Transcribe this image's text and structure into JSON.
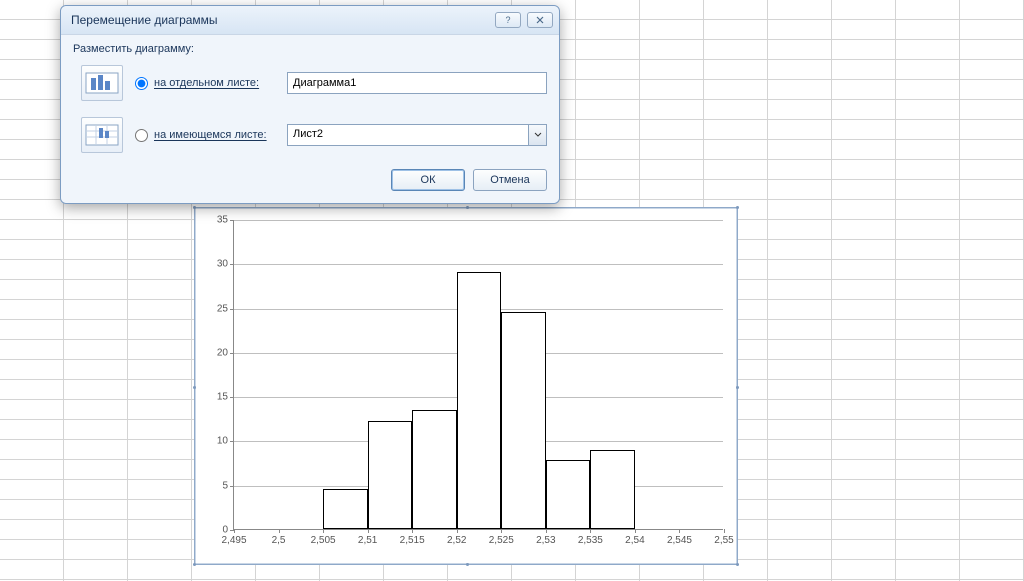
{
  "dialog": {
    "title": "Перемещение диаграммы",
    "group_label": "Разместить диаграмму:",
    "option_new_sheet": {
      "label": "на отдельном листе:",
      "value": "Диаграмма1",
      "selected": true
    },
    "option_existing_sheet": {
      "label": "на имеющемся листе:",
      "value": "Лист2",
      "selected": false
    },
    "ok_label": "ОК",
    "cancel_label": "Отмена"
  },
  "chart_data": {
    "type": "bar",
    "bin_edges": [
      2.5,
      2.505,
      2.51,
      2.515,
      2.52,
      2.525,
      2.53,
      2.535,
      2.54,
      2.545
    ],
    "values": [
      4.5,
      12.2,
      13.4,
      29,
      24.5,
      7.8,
      8.9
    ],
    "bar_start_index": 1,
    "title": "",
    "xlabel": "",
    "ylabel": "",
    "x_ticks": [
      2.495,
      2.5,
      2.505,
      2.51,
      2.515,
      2.52,
      2.525,
      2.53,
      2.535,
      2.54,
      2.545,
      2.55
    ],
    "x_tick_labels": [
      "2,495",
      "2,5",
      "2,505",
      "2,51",
      "2,515",
      "2,52",
      "2,525",
      "2,53",
      "2,535",
      "2,54",
      "2,545",
      "2,55"
    ],
    "y_ticks": [
      0,
      5,
      10,
      15,
      20,
      25,
      30,
      35
    ],
    "ylim": [
      0,
      35
    ],
    "xlim": [
      2.495,
      2.55
    ]
  }
}
